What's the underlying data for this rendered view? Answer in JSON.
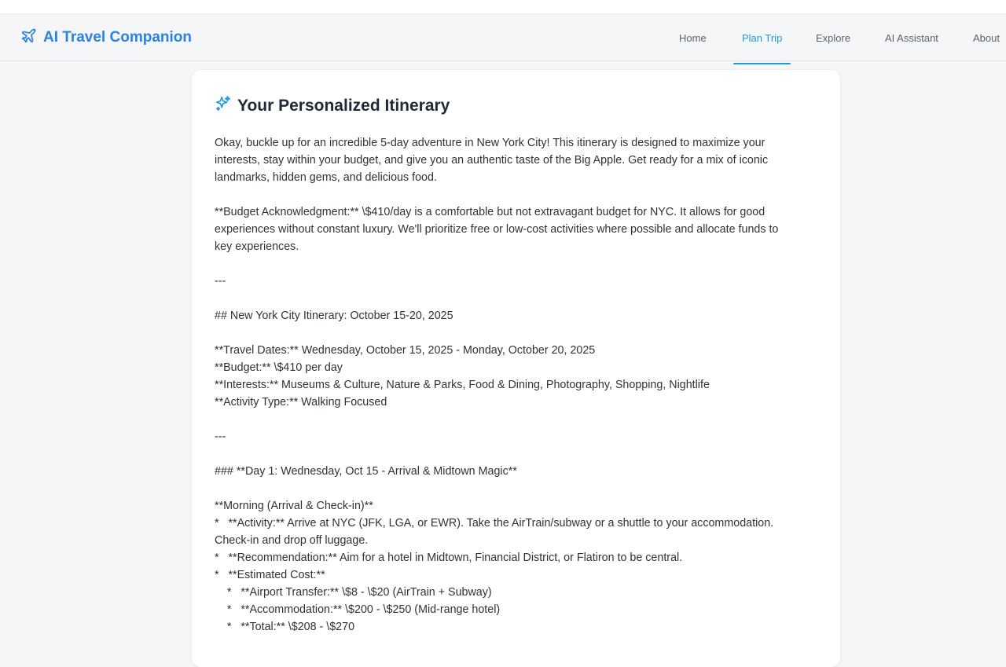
{
  "app": {
    "title": "AI Travel Companion",
    "brand_icon": "plane-icon",
    "accent_color": "#1e9ad6"
  },
  "nav": {
    "items": [
      {
        "label": "Home",
        "active": false
      },
      {
        "label": "Plan Trip",
        "active": true
      },
      {
        "label": "Explore",
        "active": false
      },
      {
        "label": "AI Assistant",
        "active": false
      },
      {
        "label": "About",
        "active": false
      }
    ]
  },
  "itinerary": {
    "title_icon": "sparkles-icon",
    "title": "Your Personalized Itinerary",
    "lines": [
      "Okay, buckle up for an incredible 5-day adventure in New York City! This itinerary is designed to maximize your",
      "interests, stay within your budget, and give you an authentic taste of the Big Apple. Get ready for a mix of iconic",
      "landmarks, hidden gems, and delicious food.",
      "",
      "**Budget Acknowledgment:** \\$410/day is a comfortable but not extravagant budget for NYC. It allows for good",
      "experiences without constant luxury. We'll prioritize free or low-cost activities where possible and allocate funds to",
      "key experiences.",
      "",
      "---",
      "",
      "## New York City Itinerary: October 15-20, 2025",
      "",
      "**Travel Dates:** Wednesday, October 15, 2025 - Monday, October 20, 2025",
      "**Budget:** \\$410 per day",
      "**Interests:** Museums & Culture, Nature & Parks, Food & Dining, Photography, Shopping, Nightlife",
      "**Activity Type:** Walking Focused",
      "",
      "---",
      "",
      "### **Day 1: Wednesday, Oct 15 - Arrival & Midtown Magic**",
      "",
      "**Morning (Arrival & Check-in)**",
      "*   **Activity:** Arrive at NYC (JFK, LGA, or EWR). Take the AirTrain/subway or a shuttle to your accommodation.",
      "Check-in and drop off luggage.",
      "*   **Recommendation:** Aim for a hotel in Midtown, Financial District, or Flatiron to be central.",
      "*   **Estimated Cost:**",
      "    *   **Airport Transfer:** \\$8 - \\$20 (AirTrain + Subway)",
      "    *   **Accommodation:** \\$200 - \\$250 (Mid-range hotel)",
      "    *   **Total:** \\$208 - \\$270"
    ]
  }
}
